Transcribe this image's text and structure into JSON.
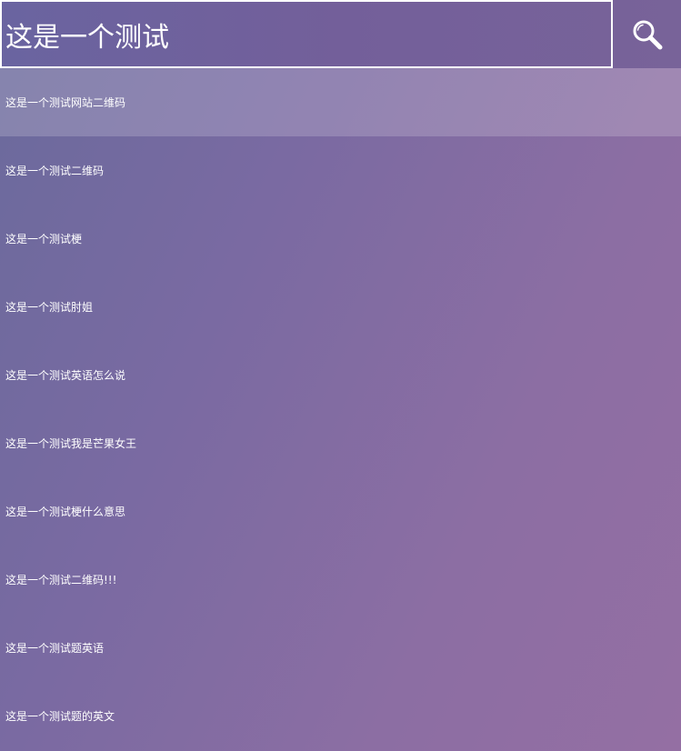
{
  "search": {
    "value": "这是一个测试",
    "button_icon": "search-icon"
  },
  "suggestions": [
    {
      "label": "这是一个测试网站二维码",
      "highlighted": true
    },
    {
      "label": "这是一个测试二维码",
      "highlighted": false
    },
    {
      "label": "这是一个测试梗",
      "highlighted": false
    },
    {
      "label": "这是一个测试肘姐",
      "highlighted": false
    },
    {
      "label": "这是一个测试英语怎么说",
      "highlighted": false
    },
    {
      "label": "这是一个测试我是芒果女王",
      "highlighted": false
    },
    {
      "label": "这是一个测试梗什么意思",
      "highlighted": false
    },
    {
      "label": "这是一个测试二维码!!!",
      "highlighted": false
    },
    {
      "label": "这是一个测试题英语",
      "highlighted": false
    },
    {
      "label": "这是一个测试题的英文",
      "highlighted": false
    }
  ],
  "colors": {
    "text": "#ffffff",
    "highlight": "rgba(255,255,255,0.18)"
  }
}
